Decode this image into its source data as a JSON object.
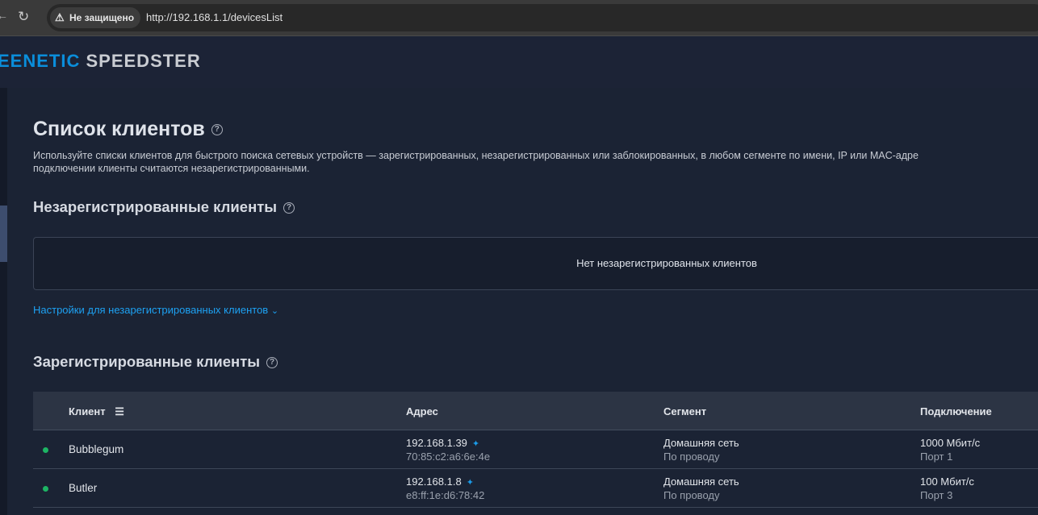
{
  "browser": {
    "security_label": "Не защищено",
    "url": "http://192.168.1.1/devicesList"
  },
  "brand": {
    "part1": "EENETIC",
    "part2": "SPEEDSTER"
  },
  "page": {
    "title": "Список клиентов",
    "description_line1": "Используйте списки клиентов для быстрого поиска сетевых устройств — зарегистрированных, незарегистрированных или заблокированных, в любом сегменте по имени, IP или MAC-адре",
    "description_line2": "подключении клиенты считаются незарегистрированными."
  },
  "unregistered": {
    "title": "Незарегистрированные клиенты",
    "empty_text": "Нет незарегистрированных клиентов",
    "settings_link": "Настройки для незарегистрированных клиентов"
  },
  "registered": {
    "title": "Зарегистрированные клиенты",
    "columns": {
      "client": "Клиент",
      "address": "Адрес",
      "segment": "Сегмент",
      "connection": "Подключение"
    },
    "rows": [
      {
        "name": "Bubblegum",
        "ip": "192.168.1.39",
        "mac": "70:85:c2:a6:6e:4e",
        "segment": "Домашняя сеть",
        "segment_type": "По проводу",
        "speed": "1000 Мбит/с",
        "port": "Порт 1",
        "status_color": "#1db464"
      },
      {
        "name": "Butler",
        "ip": "192.168.1.8",
        "mac": "e8:ff:1e:d6:78:42",
        "segment": "Домашняя сеть",
        "segment_type": "По проводу",
        "speed": "100 Мбит/с",
        "port": "Порт 3",
        "status_color": "#1db464"
      }
    ]
  }
}
